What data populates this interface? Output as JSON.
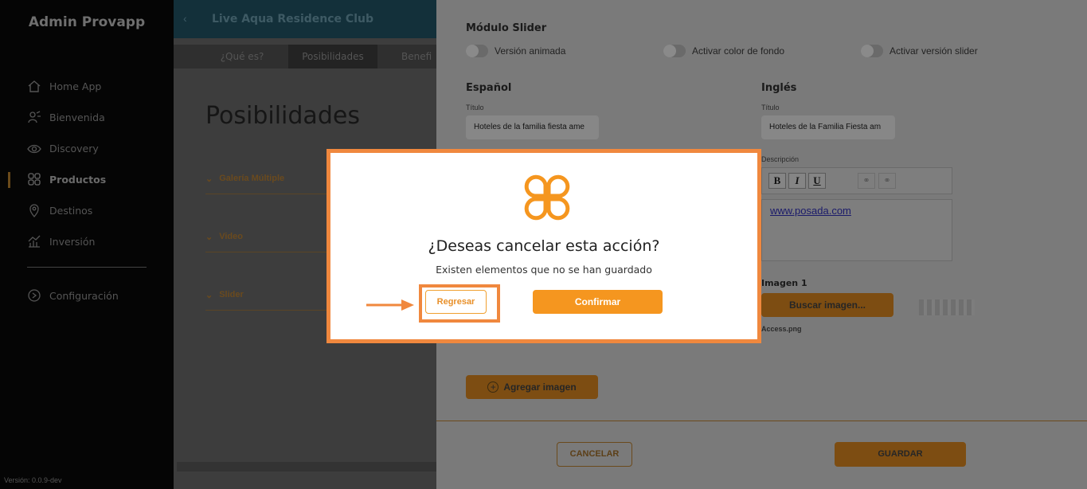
{
  "sidebar": {
    "brand": "Admin Provapp",
    "items": [
      {
        "label": "Home App",
        "icon": "home-icon"
      },
      {
        "label": "Bienvenida",
        "icon": "welcome-icon"
      },
      {
        "label": "Discovery",
        "icon": "eye-icon"
      },
      {
        "label": "Productos",
        "icon": "grid-icon",
        "active": true
      },
      {
        "label": "Destinos",
        "icon": "location-pin-icon"
      },
      {
        "label": "Inversión",
        "icon": "chart-icon"
      }
    ],
    "config_label": "Configuración",
    "version": "Versión: 0.0.9-dev"
  },
  "content": {
    "topbar_title": "Live Aqua Residence Club",
    "tabs": [
      "¿Qué es?",
      "Posibilidades",
      "Benefi"
    ],
    "active_tab": "Posibilidades",
    "page_title": "Posibilidades",
    "sections": [
      "Galería Múltiple",
      "Video",
      "Slider"
    ]
  },
  "panel": {
    "module_title": "Módulo Slider",
    "toggles": [
      "Versión animada",
      "Activar color de fondo",
      "Activar versión slider"
    ],
    "spanish": {
      "heading": "Español",
      "title_label": "Título",
      "title_value": "Hoteles de la familia fiesta ame"
    },
    "english": {
      "heading": "Inglés",
      "title_label": "Título",
      "title_value": "Hoteles de la Familia Fiesta am",
      "description_label": "Descripción",
      "editor_link": "www.posada.com",
      "image_label": "Imagen 1",
      "search_image_button": "Buscar imagen...",
      "file_name": "Access.png"
    },
    "add_image_button": "Agregar imagen",
    "cancel_button": "CANCELAR",
    "save_button": "GUARDAR"
  },
  "modal": {
    "title": "¿Deseas cancelar esta acción?",
    "message": "Existen elementos que no se han guardado",
    "back_button": "Regresar",
    "confirm_button": "Confirmar"
  },
  "colors": {
    "accent": "#f5961f",
    "highlight": "#f0883e"
  }
}
